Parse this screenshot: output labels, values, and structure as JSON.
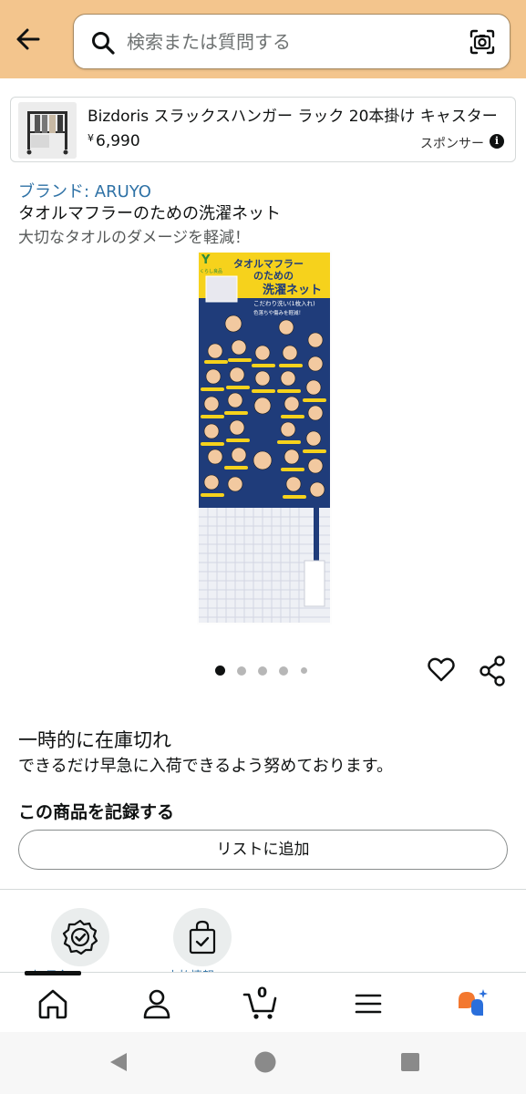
{
  "header": {
    "search_placeholder": "検索または質問する",
    "back_icon": "arrow-left-icon",
    "search_icon": "magnifier-icon",
    "camera_icon": "camera-lens-icon",
    "background_color": "#f3c58d"
  },
  "sponsored_ad": {
    "title": "Bizdoris スラックスハンガー ラック 20本掛け キャスター",
    "price_symbol": "¥",
    "price": "6,990",
    "sponsor_label": "スポンサー"
  },
  "product": {
    "brand_link": "ブランド: ARUYO",
    "title": "タオルマフラーのための洗濯ネット",
    "subtitle": "大切なタオルのダメージを軽減！",
    "image_text": {
      "line1": "タオルマフラー",
      "line2": "のための",
      "line3": "洗濯ネット",
      "note1": "こだわり洗い(1枚入れ)",
      "note2": "色落ちや傷みを軽減！",
      "logo": "くらし良品"
    },
    "image_count": 5,
    "active_image": 1
  },
  "availability": {
    "status": "一時的に在庫切れ",
    "message": "できるだけ早急に入荷できるよう努めております。"
  },
  "track": {
    "title": "この商品を記録する",
    "add_to_list_label": "リストに追加"
  },
  "features": [
    {
      "icon": "badge-check-icon",
      "label": "本 保全"
    },
    {
      "icon": "secure-bag-icon",
      "label": "+ 支払情報"
    }
  ],
  "bottom_nav": {
    "cart_count": "0",
    "items": [
      "home-icon",
      "account-icon",
      "cart-icon",
      "menu-icon",
      "rufus-icon"
    ]
  },
  "colors": {
    "link": "#2f72a6",
    "rufus_orange": "#f3782f",
    "rufus_blue": "#2a6fdb"
  }
}
